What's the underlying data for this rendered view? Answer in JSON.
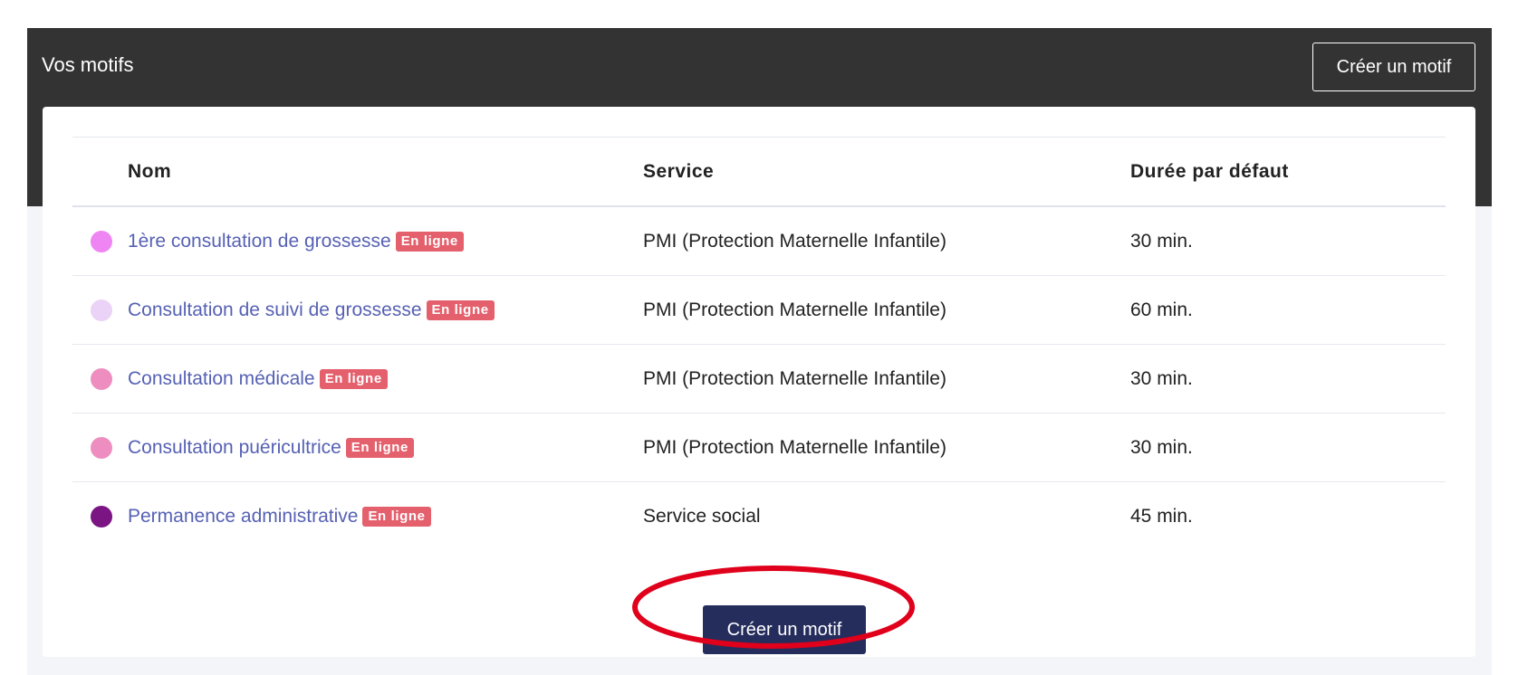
{
  "header": {
    "title": "Vos motifs",
    "create_button_label": "Créer un motif"
  },
  "table": {
    "columns": [
      "Nom",
      "Service",
      "Durée par défaut"
    ],
    "rows": [
      {
        "color": "#ef84f3",
        "name": "1ère consultation de grossesse",
        "badge": "En ligne",
        "service": "PMI (Protection Maternelle Infantile)",
        "duration": "30 min."
      },
      {
        "color": "#ebd3f7",
        "name": "Consultation de suivi de grossesse",
        "badge": "En ligne",
        "service": "PMI (Protection Maternelle Infantile)",
        "duration": "60 min."
      },
      {
        "color": "#ee8ec0",
        "name": "Consultation médicale",
        "badge": "En ligne",
        "service": "PMI (Protection Maternelle Infantile)",
        "duration": "30 min."
      },
      {
        "color": "#ee8ec0",
        "name": "Consultation puéricultrice",
        "badge": "En ligne",
        "service": "PMI (Protection Maternelle Infantile)",
        "duration": "30 min."
      },
      {
        "color": "#7b1583",
        "name": "Permanence administrative",
        "badge": "En ligne",
        "service": "Service social",
        "duration": "45 min."
      }
    ]
  },
  "footer": {
    "create_button_label": "Créer un motif"
  },
  "colors": {
    "header_bg": "#333333",
    "page_bg": "#f4f5f9",
    "link": "#5661b3",
    "badge_bg": "#e4606d",
    "primary_button": "#252d5c",
    "annotation": "#e0001b"
  }
}
